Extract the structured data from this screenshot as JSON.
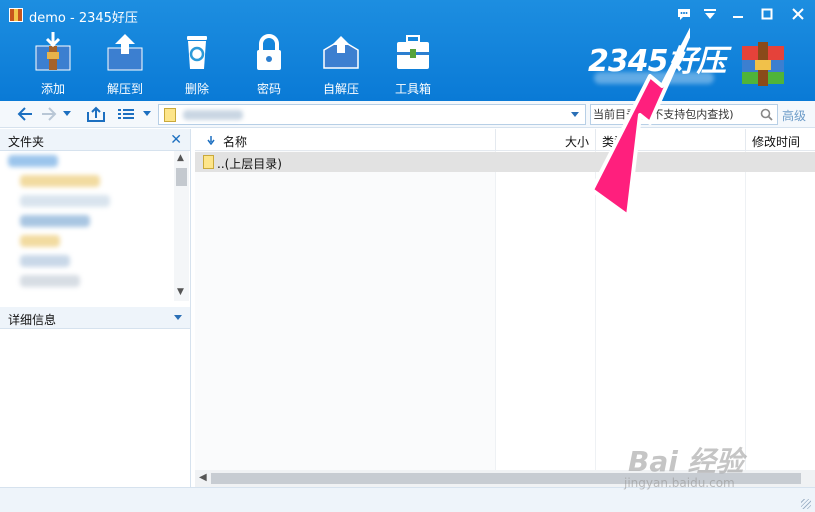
{
  "window": {
    "title": "demo - 2345好压"
  },
  "toolbar": {
    "items": [
      {
        "label": "添加",
        "icon": "add-archive-icon"
      },
      {
        "label": "解压到",
        "icon": "extract-to-icon"
      },
      {
        "label": "删除",
        "icon": "recycle-bin-icon"
      },
      {
        "label": "密码",
        "icon": "padlock-icon"
      },
      {
        "label": "自解压",
        "icon": "self-extract-icon"
      },
      {
        "label": "工具箱",
        "icon": "toolbox-icon"
      }
    ]
  },
  "brand": {
    "text": "2345好压"
  },
  "search": {
    "placeholder": "当前目录下(不支持包内查找)",
    "advanced_label": "高级"
  },
  "left_panel": {
    "folders_title": "文件夹",
    "details_title": "详细信息"
  },
  "file_list": {
    "columns": [
      "名称",
      "大小",
      "类型",
      "修改时间"
    ],
    "rows": [
      {
        "name": "..(上层目录)"
      }
    ]
  },
  "watermark": {
    "brand": "Bai 经验",
    "url": "jingyan.baidu.com"
  },
  "colors": {
    "header_blue": "#0a7ad6",
    "accent_pink": "#ff1f7d",
    "address_bg": "#f4f8fc"
  }
}
